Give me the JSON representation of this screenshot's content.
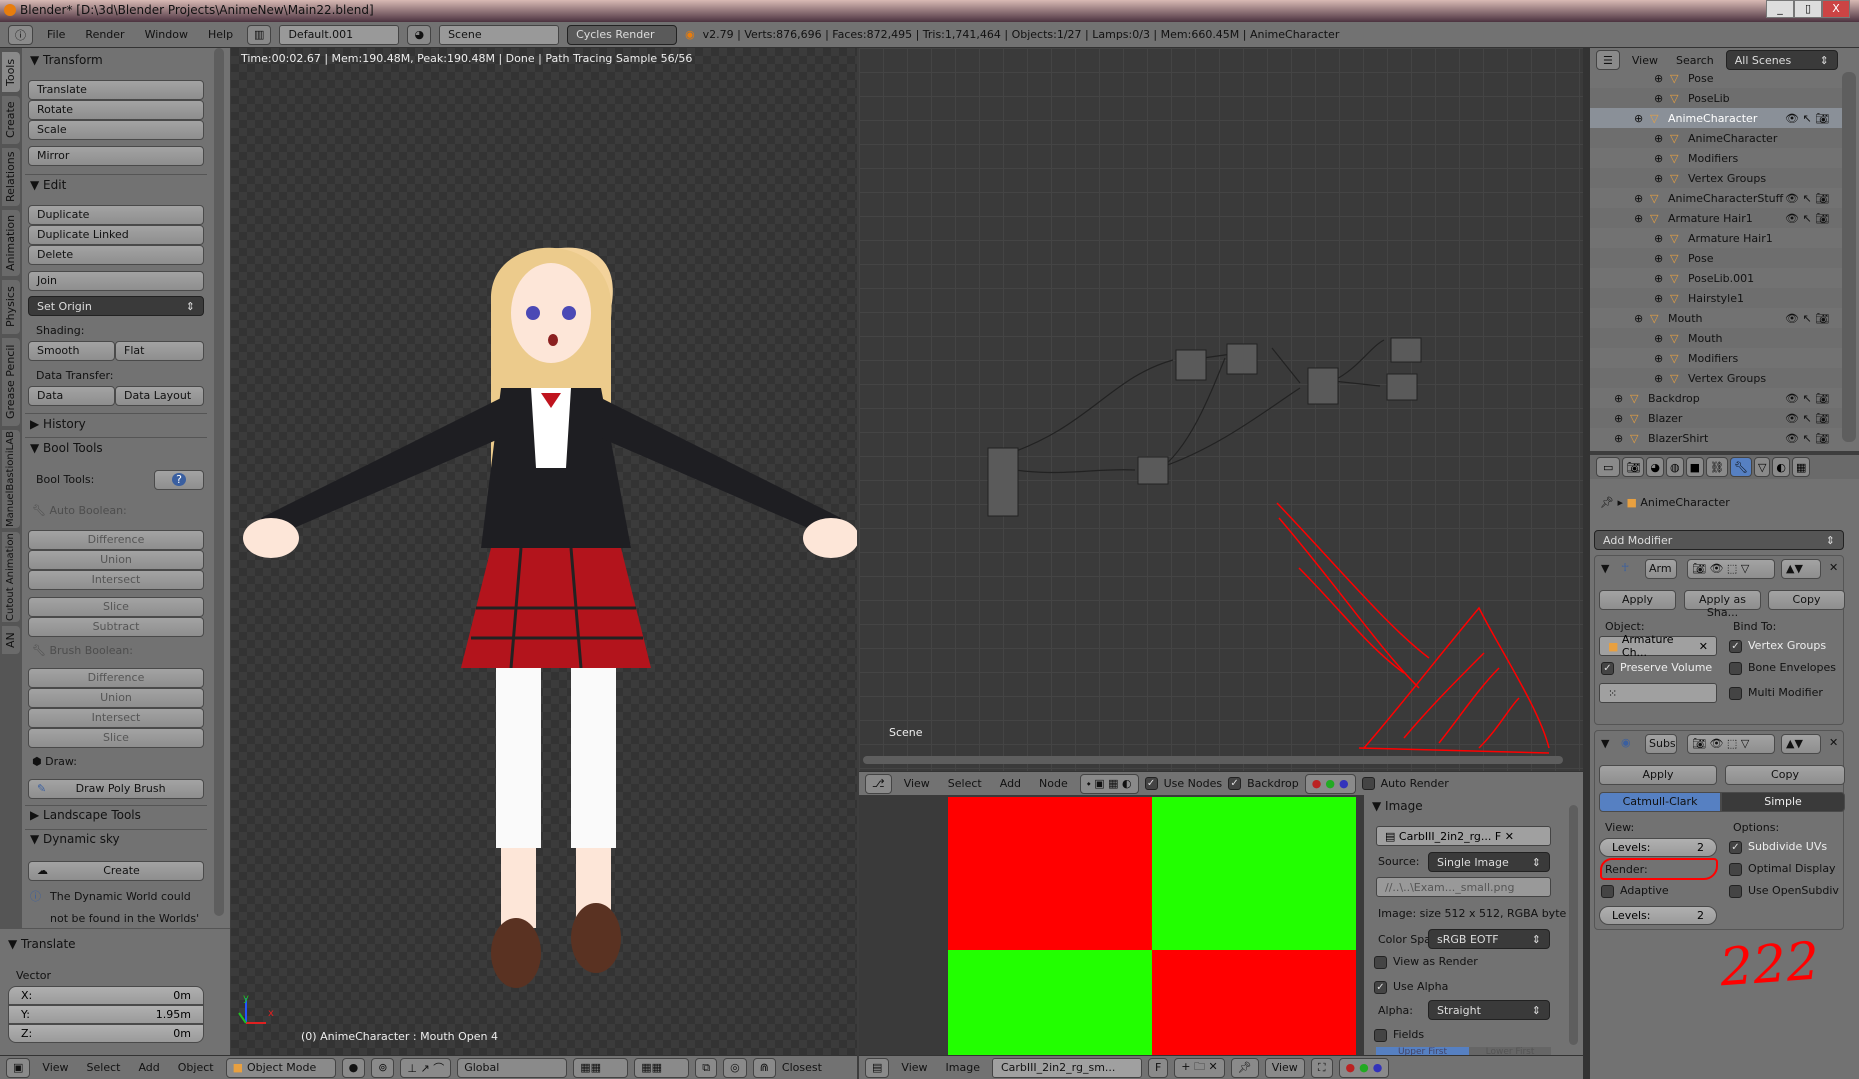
{
  "window": {
    "title": "Blender* [D:\\3d\\Blender Projects\\AnimeNew\\Main22.blend]",
    "minimize": "_",
    "restore": "▯",
    "close": "X"
  },
  "topbar": {
    "menus": [
      "File",
      "Render",
      "Window",
      "Help"
    ],
    "layout": "Default.001",
    "scene": "Scene",
    "engine": "Cycles Render",
    "stats": "v2.79 | Verts:876,696 | Faces:872,495 | Tris:1,741,464 | Objects:1/27 | Lamps:0/3 | Mem:660.45M | AnimeCharacter"
  },
  "tool_tabs": [
    "Tools",
    "Create",
    "Relations",
    "Animation",
    "Physics",
    "Grease Pencil",
    "ManuelBastioniLAB",
    "Cutout Animation",
    "AN"
  ],
  "toolshelf": {
    "transform": {
      "title": "Transform",
      "buttons": [
        "Translate",
        "Rotate",
        "Scale",
        "Mirror"
      ]
    },
    "edit": {
      "title": "Edit",
      "buttons": [
        "Duplicate",
        "Duplicate Linked",
        "Delete",
        "Join"
      ],
      "set_origin": "Set Origin",
      "shading_label": "Shading:",
      "smooth": "Smooth",
      "flat": "Flat",
      "data_transfer_label": "Data Transfer:",
      "data": "Data",
      "data_layout": "Data Layout"
    },
    "history": "History",
    "bool_tools": {
      "title": "Bool Tools",
      "label": "Bool Tools:",
      "help": "?",
      "auto_label": "Auto Boolean:",
      "auto": [
        "Difference",
        "Union",
        "Intersect",
        "Slice",
        "Subtract"
      ],
      "brush_label": "Brush Boolean:",
      "brush": [
        "Difference",
        "Union",
        "Intersect",
        "Slice"
      ],
      "draw_label": "Draw:",
      "draw_poly": "Draw Poly Brush"
    },
    "landscape": "Landscape Tools",
    "dynamic_sky": {
      "title": "Dynamic sky",
      "create": "Create",
      "info": "The Dynamic World could not be found in the Worlds' Data"
    }
  },
  "redo": {
    "title": "Translate",
    "vector": "Vector",
    "x_label": "X:",
    "x": "0m",
    "y_label": "Y:",
    "y": "1.95m",
    "z_label": "Z:",
    "z": "0m"
  },
  "viewport": {
    "render_info": "Time:00:02.67 | Mem:190.48M, Peak:190.48M | Done | Path Tracing Sample 56/56",
    "object_info": "(0) AnimeCharacter : Mouth Open 4",
    "axis_x": "x",
    "axis_y": "y"
  },
  "view3d_header": {
    "menus": [
      "View",
      "Select",
      "Add",
      "Object"
    ],
    "mode": "Object Mode",
    "orientation": "Global",
    "snap": "Closest"
  },
  "node_editor": {
    "label": "Scene",
    "menus": [
      "View",
      "Select",
      "Add",
      "Node"
    ],
    "use_nodes": "Use Nodes",
    "backdrop": "Backdrop",
    "auto_render": "Auto Render",
    "use_nodes_checked": true,
    "backdrop_checked": true
  },
  "image_editor": {
    "menus": [
      "View",
      "Image"
    ],
    "image_name": "CarbIII_2in2_rg_sm...",
    "fake_user": "F",
    "view": "View",
    "colors": {
      "red": "#ff0000",
      "green": "#22ff00"
    }
  },
  "image_panel": {
    "title": "Image",
    "datablock": "CarbIII_2in2_rg...",
    "f": "F",
    "source_label": "Source:",
    "source": "Single Image",
    "filepath": "//..\\..\\Exam..._small.png",
    "info": "Image: size 512 x 512, RGBA byte",
    "colorspace_label": "Color Spac",
    "colorspace": "sRGB EOTF",
    "view_as_render": "View as Render",
    "use_alpha": "Use Alpha",
    "alpha_label": "Alpha:",
    "alpha": "Straight",
    "fields": "Fields",
    "upper_first": "Upper First",
    "lower_first": "Lower First"
  },
  "outliner": {
    "menus": [
      "View",
      "Search"
    ],
    "filter": "All Scenes",
    "rows": [
      {
        "name": "Pose",
        "indent": 3
      },
      {
        "name": "PoseLib",
        "indent": 3
      },
      {
        "name": "AnimeCharacter",
        "indent": 2,
        "selected": true
      },
      {
        "name": "AnimeCharacter",
        "indent": 3
      },
      {
        "name": "Modifiers",
        "indent": 3
      },
      {
        "name": "Vertex Groups",
        "indent": 3
      },
      {
        "name": "AnimeCharacterStuff",
        "indent": 2
      },
      {
        "name": "Armature Hair1",
        "indent": 2
      },
      {
        "name": "Armature Hair1",
        "indent": 3
      },
      {
        "name": "Pose",
        "indent": 3
      },
      {
        "name": "PoseLib.001",
        "indent": 3
      },
      {
        "name": "Hairstyle1",
        "indent": 3
      },
      {
        "name": "Mouth",
        "indent": 2
      },
      {
        "name": "Mouth",
        "indent": 3
      },
      {
        "name": "Modifiers",
        "indent": 3
      },
      {
        "name": "Vertex Groups",
        "indent": 3
      },
      {
        "name": "Backdrop",
        "indent": 1
      },
      {
        "name": "Blazer",
        "indent": 1
      },
      {
        "name": "BlazerShirt",
        "indent": 1
      }
    ]
  },
  "properties": {
    "object": "AnimeCharacter",
    "add_modifier": "Add Modifier",
    "armature": {
      "name": "Arm",
      "apply": "Apply",
      "apply_shape": "Apply as Sha...",
      "copy": "Copy",
      "object_label": "Object:",
      "object": "Armature Ch...",
      "bind_label": "Bind To:",
      "vertex_groups": "Vertex Groups",
      "bone_envelopes": "Bone Envelopes",
      "preserve_volume": "Preserve Volume",
      "multi_modifier": "Multi Modifier"
    },
    "subsurf": {
      "name": "Subs",
      "apply": "Apply",
      "copy": "Copy",
      "catmull": "Catmull-Clark",
      "simple": "Simple",
      "view_label": "View:",
      "levels_label": "Levels:",
      "levels": "2",
      "render_label": "Render:",
      "adaptive": "Adaptive",
      "render_levels": "2",
      "options_label": "Options:",
      "subdivide_uvs": "Subdivide UVs",
      "optimal_display": "Optimal Display",
      "use_opensubdiv": "Use OpenSubdiv"
    }
  },
  "annotation": {
    "scribble": "222",
    "color": "#ff0000"
  },
  "accent": "#5680c2"
}
